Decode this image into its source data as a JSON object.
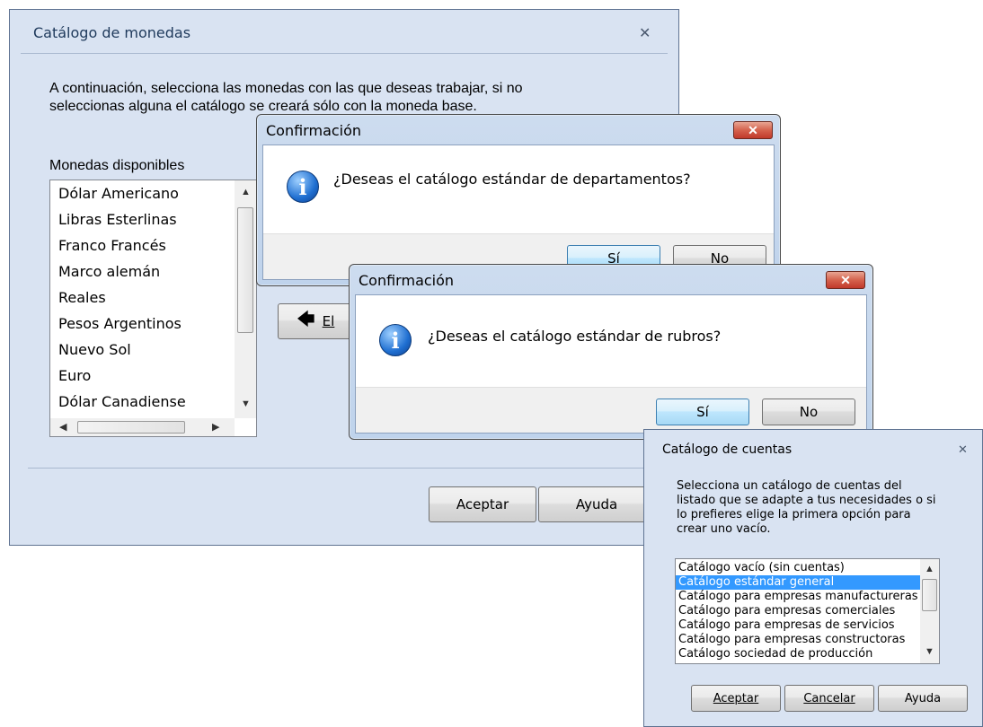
{
  "monedas": {
    "title": "Catálogo de monedas",
    "instructions": "A continuación, selecciona las monedas con las que deseas trabajar, si no seleccionas alguna el catálogo se creará sólo con la moneda base.",
    "list_label": "Monedas disponibles",
    "items": [
      "Dólar Americano",
      "Libras Esterlinas",
      "Franco Francés",
      "Marco alemán",
      "Reales",
      "Pesos Argentinos",
      "Nuevo Sol",
      "Euro",
      "Dólar Canadiense"
    ],
    "eliminar_label": "El",
    "aceptar_label": "Aceptar",
    "ayuda_label": "Ayuda"
  },
  "confirm1": {
    "title": "Confirmación",
    "message": "¿Deseas el catálogo estándar de departamentos?",
    "yes": "Sí",
    "no": "No"
  },
  "confirm2": {
    "title": "Confirmación",
    "message": "¿Deseas el catálogo estándar de rubros?",
    "yes": "Sí",
    "no": "No"
  },
  "cuentas": {
    "title": "Catálogo de cuentas",
    "instructions": "Selecciona un catálogo de cuentas del listado que se adapte a tus necesidades o si lo prefieres elige la primera opción para crear uno vacío.",
    "items": [
      "Catálogo vacío (sin cuentas)",
      "Catálogo estándar general",
      "Catálogo para empresas manufactureras",
      "Catálogo para empresas comerciales",
      "Catálogo para empresas de servicios",
      "Catálogo para empresas constructoras",
      "Catálogo sociedad de producción"
    ],
    "selected_index": 1,
    "aceptar_label": "Aceptar",
    "cancelar_label": "Cancelar",
    "ayuda_label": "Ayuda"
  },
  "icons": {
    "close": "✕",
    "info": "i"
  },
  "colors": {
    "selection": "#3399ff",
    "dialog_bg": "#d9e3f2",
    "close_red": "#c0392b"
  }
}
